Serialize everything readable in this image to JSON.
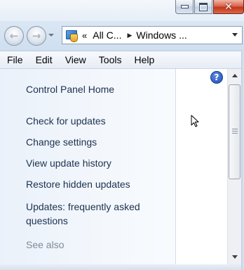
{
  "address_bar": {
    "chevron": "«",
    "crumb1": "All C...",
    "crumb2": "Windows ..."
  },
  "menu": [
    "File",
    "Edit",
    "View",
    "Tools",
    "Help"
  ],
  "task_pane": {
    "home": "Control Panel Home",
    "links": [
      "Check for updates",
      "Change settings",
      "View update history",
      "Restore hidden updates",
      "Updates: frequently asked questions"
    ],
    "see_also": "See also"
  },
  "help_glyph": "?",
  "icons": {
    "back": "back-arrow-icon",
    "forward": "forward-arrow-icon",
    "control_panel": "control-panel-icon",
    "help": "help-icon",
    "cursor": "mouse-cursor-icon"
  },
  "colors": {
    "close_button": "#c3371b",
    "link_text": "#1b3150",
    "see_also": "#7f8a97",
    "help_icon": "#1f4fb8"
  }
}
